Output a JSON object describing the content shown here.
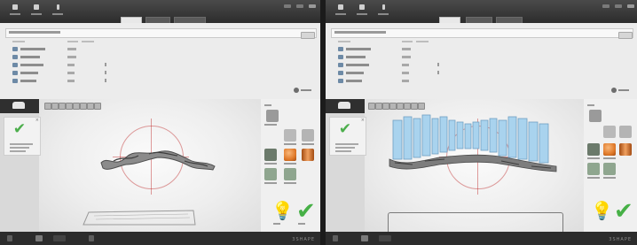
{
  "brand": "3SHAPE",
  "colors": {
    "titlebar": "#333333",
    "check_green": "#46b046",
    "scan_blue": "#a9d3ee",
    "crosshair_red": "#be2828",
    "orange_sphere": "#e07a2a"
  },
  "panes": [
    {
      "id": "left",
      "toolbar_icons": [
        "home-icon",
        "save-icon",
        "info-icon"
      ],
      "tabs": 3,
      "active_tab": 0,
      "scan_rows": 5,
      "right_tools": [
        "gum-tool-icon",
        "cut-tool-icon",
        "trim-tool-icon",
        "fill-tool-icon",
        "sphere-tool-icon",
        "cylinder-tool-icon",
        "smooth-tool-icon",
        "sculpt-tool-icon",
        "hint-bulb-icon",
        "next-check-icon"
      ]
    },
    {
      "id": "right",
      "toolbar_icons": [
        "home-icon",
        "save-icon",
        "info-icon"
      ],
      "tabs": 3,
      "active_tab": 0,
      "scan_rows": 5,
      "right_tools": [
        "gum-tool-icon",
        "cut-tool-icon",
        "trim-tool-icon",
        "fill-tool-icon",
        "sphere-tool-icon",
        "cylinder-tool-icon",
        "smooth-tool-icon",
        "sculpt-tool-icon",
        "hint-bulb-icon",
        "next-check-icon"
      ]
    }
  ]
}
